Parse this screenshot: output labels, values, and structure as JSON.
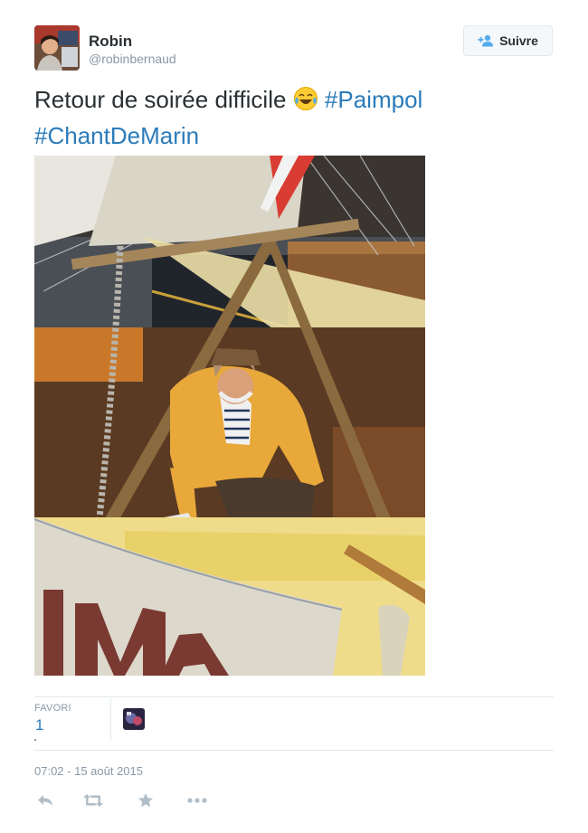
{
  "user": {
    "name": "Robin",
    "handle": "@robinbernaud"
  },
  "follow": {
    "label": "Suivre",
    "icon": "add-user-icon"
  },
  "tweet": {
    "text": "Retour de soirée difficile",
    "emoji": "face-with-tears-of-joy",
    "hashtags": [
      "#Paimpol",
      "#ChantDeMarin"
    ]
  },
  "photo": {
    "subject": "photo-of-sleeping-sailor-on-boat"
  },
  "stats": {
    "favorites_label": "FAVORI",
    "favorites_count": "1"
  },
  "timestamp": "07:02 - 15 août 2015",
  "actions": [
    "reply-icon",
    "retweet-icon",
    "favorite-icon",
    "more-icon"
  ],
  "colors": {
    "link": "#2b7bb9",
    "text": "#292f33",
    "muted": "#8899a6",
    "border": "#e1e8ed"
  }
}
